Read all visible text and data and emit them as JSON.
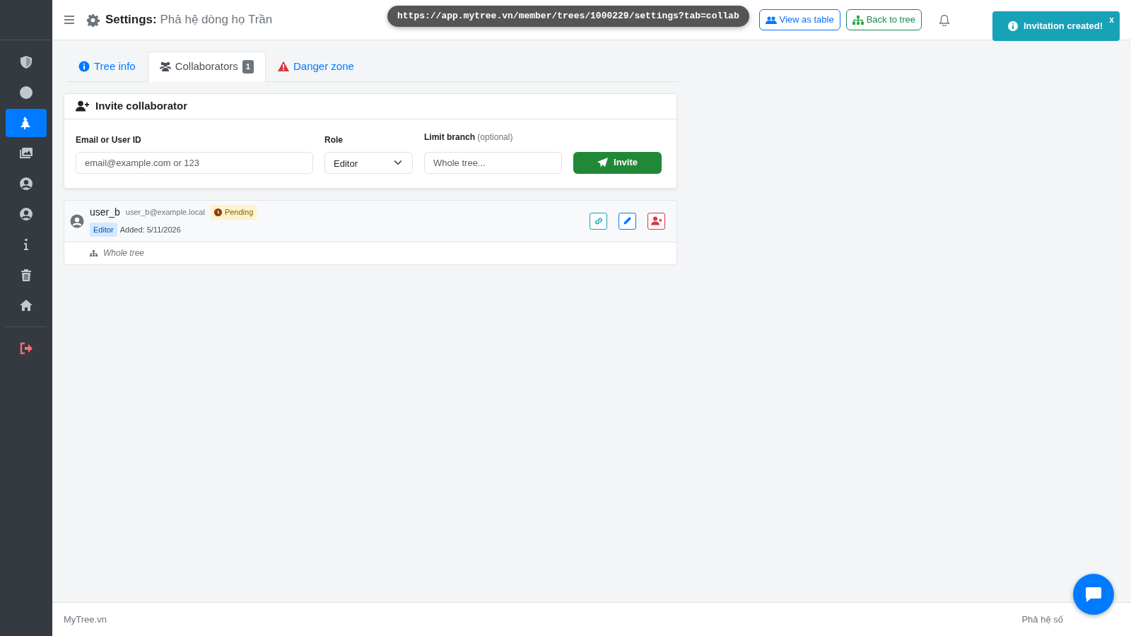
{
  "sidebar": {
    "items": [
      {
        "kind": "shield",
        "selected": false
      },
      {
        "kind": "dot",
        "selected": false
      },
      {
        "kind": "tree",
        "selected": true
      },
      {
        "kind": "images",
        "selected": false
      },
      {
        "kind": "user",
        "selected": false
      },
      {
        "kind": "user",
        "selected": false
      },
      {
        "kind": "info",
        "selected": false
      },
      {
        "kind": "trash",
        "selected": false
      },
      {
        "kind": "home",
        "selected": false
      }
    ],
    "logout": {
      "kind": "logout"
    }
  },
  "header": {
    "title_label": "Settings:",
    "title_value": "Phả hệ dòng họ Trần",
    "buttons": [
      {
        "label": "View as table",
        "kind": "table"
      },
      {
        "label": "Back to tree",
        "kind": "tree"
      }
    ]
  },
  "url_bar": "https://app.mytree.vn/member/trees/1000229/settings?tab=collab",
  "toast": {
    "message": "Invitation created!",
    "close": "x"
  },
  "tabs": [
    {
      "label": "Tree info",
      "kind": "info",
      "selected": false
    },
    {
      "label": "Collaborators",
      "kind": "people",
      "badge": "1",
      "selected": true
    },
    {
      "label": "Danger zone",
      "kind": "danger",
      "selected": false
    }
  ],
  "invite": {
    "title": "Invite collaborator",
    "email_label": "Email or User ID",
    "email_placeholder": "email@example.com or 123",
    "role_label": "Role",
    "role_value": "Editor",
    "branch_label": "Limit branch",
    "branch_hint": "(optional)",
    "branch_placeholder": "Whole tree...",
    "button": "Invite"
  },
  "collaborators": [
    {
      "username": "user_b",
      "email": "user_b@example.local",
      "status": "Pending",
      "role": "Editor",
      "added": "Added: 5/11/2026",
      "branch": "Whole tree"
    }
  ],
  "footer": {
    "left": "MyTree.vn",
    "right": "Phả hệ số"
  }
}
